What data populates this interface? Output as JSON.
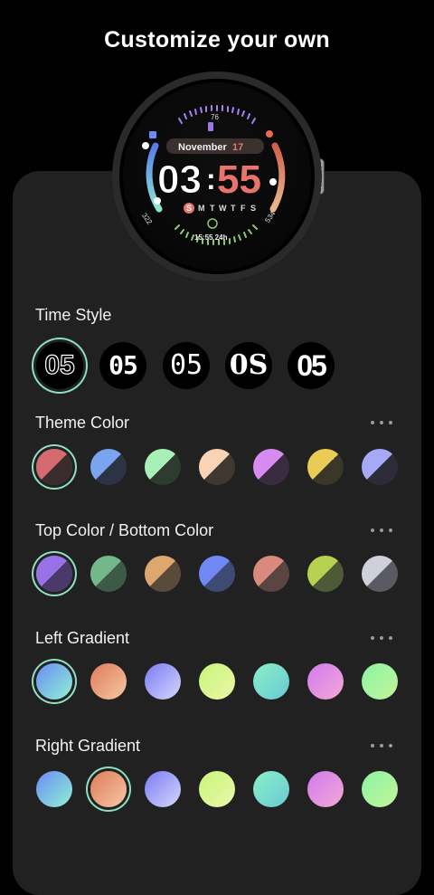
{
  "header": {
    "title": "Customize your own"
  },
  "watch": {
    "date_month": "November",
    "date_day": "17",
    "time_hour": "03",
    "time_min": "55",
    "days": [
      "S",
      "M",
      "T",
      "W",
      "T",
      "F",
      "S"
    ],
    "top_value": "76",
    "left_value": "322",
    "right_value": "534",
    "alarm": "15:55 24h",
    "accent": "#e8736d"
  },
  "time_style": {
    "title": "Time Style",
    "options": [
      {
        "label": "05",
        "selected": true
      },
      {
        "label": "05",
        "selected": false
      },
      {
        "label": "05",
        "selected": false
      },
      {
        "label": "0S",
        "selected": false
      },
      {
        "label": "05",
        "selected": false
      }
    ]
  },
  "theme_color": {
    "title": "Theme Color",
    "swatches": [
      {
        "top": "#d46a6d",
        "bottom": "#3a2b2d",
        "selected": true
      },
      {
        "top": "#7aa3f0",
        "bottom": "#2b3345",
        "selected": false
      },
      {
        "top": "#a8f0b8",
        "bottom": "#2d3b30",
        "selected": false
      },
      {
        "top": "#f8d4b4",
        "bottom": "#3f3830",
        "selected": false
      },
      {
        "top": "#d68af2",
        "bottom": "#3a2c40",
        "selected": false
      },
      {
        "top": "#e8cc56",
        "bottom": "#3a3628",
        "selected": false
      },
      {
        "top": "#a8a8f8",
        "bottom": "#2b2c38",
        "selected": false
      }
    ]
  },
  "top_bottom_color": {
    "title": "Top Color / Bottom Color",
    "swatches": [
      {
        "top": "#9a72e8",
        "bottom": "#4a3a6a",
        "selected": true
      },
      {
        "top": "#74b88a",
        "bottom": "#3d5a48",
        "selected": false
      },
      {
        "top": "#dca870",
        "bottom": "#5a4a3a",
        "selected": false
      },
      {
        "top": "#6f88f4",
        "bottom": "#3d4a74",
        "selected": false
      },
      {
        "top": "#d88a7c",
        "bottom": "#5a4542",
        "selected": false
      },
      {
        "top": "#b8d050",
        "bottom": "#4e5a36",
        "selected": false
      },
      {
        "top": "#d0d0da",
        "bottom": "#5a5a62",
        "selected": false
      }
    ]
  },
  "left_gradient": {
    "title": "Left Gradient",
    "swatches": [
      {
        "from": "#6a8cf4",
        "to": "#8ff2d4",
        "selected": true
      },
      {
        "from": "#e07a5a",
        "to": "#f4c8a4",
        "selected": false
      },
      {
        "from": "#7a7af4",
        "to": "#d4d8fa",
        "selected": false
      },
      {
        "from": "#c8f47a",
        "to": "#eaf8a8",
        "selected": false
      },
      {
        "from": "#8af0c8",
        "to": "#6ac8d4",
        "selected": false
      },
      {
        "from": "#d07af0",
        "to": "#f4a8d4",
        "selected": false
      },
      {
        "from": "#8af4a4",
        "to": "#c4f49a",
        "selected": false
      }
    ]
  },
  "right_gradient": {
    "title": "Right Gradient",
    "swatches": [
      {
        "from": "#6a8cf4",
        "to": "#8ff2d4",
        "selected": false
      },
      {
        "from": "#e07a5a",
        "to": "#f4c8a4",
        "selected": true
      },
      {
        "from": "#7a7af4",
        "to": "#d4d8fa",
        "selected": false
      },
      {
        "from": "#c8f47a",
        "to": "#eaf8a8",
        "selected": false
      },
      {
        "from": "#8af0c8",
        "to": "#6ac8d4",
        "selected": false
      },
      {
        "from": "#d07af0",
        "to": "#f4a8d4",
        "selected": false
      },
      {
        "from": "#8af4a4",
        "to": "#c4f49a",
        "selected": false
      }
    ]
  }
}
